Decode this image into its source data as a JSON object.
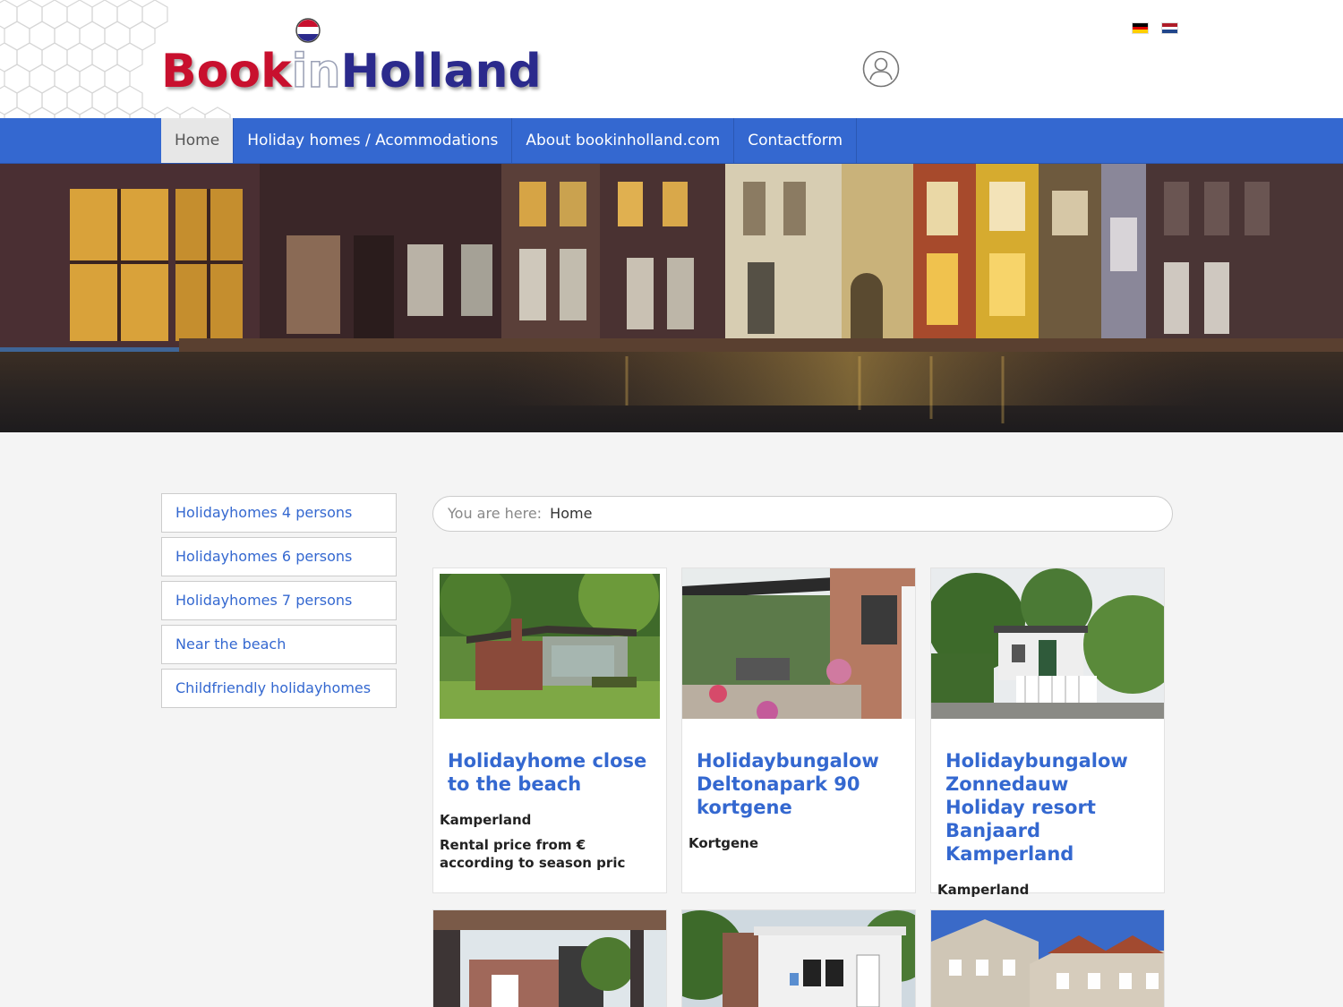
{
  "site": {
    "logo": {
      "part1": "Book",
      "part2": "in",
      "part3": "Holland"
    }
  },
  "header": {
    "languages": [
      {
        "name": "German",
        "colors": [
          "#000000",
          "#dd0000",
          "#ffce00"
        ]
      },
      {
        "name": "Dutch",
        "colors": [
          "#ae1c28",
          "#ffffff",
          "#21468b"
        ]
      }
    ]
  },
  "nav": {
    "items": [
      {
        "label": "Home",
        "active": true
      },
      {
        "label": "Holiday homes / Acommodations",
        "active": false
      },
      {
        "label": "About bookinholland.com",
        "active": false
      },
      {
        "label": "Contactform",
        "active": false
      }
    ]
  },
  "sidebar": {
    "items": [
      {
        "label": "Holidayhomes 4 persons"
      },
      {
        "label": "Holidayhomes 6 persons"
      },
      {
        "label": "Holidayhomes 7 persons"
      },
      {
        "label": "Near the beach"
      },
      {
        "label": "Childfriendly holidayhomes"
      }
    ]
  },
  "breadcrumb": {
    "label": "You are here:",
    "current": "Home"
  },
  "listings": [
    {
      "title": "Holidayhome close to the beach",
      "place": "Kamperland",
      "price": "Rental price from € according to season pric"
    },
    {
      "title": "Holidaybungalow Deltonapark 90 kortgene",
      "place": "Kortgene",
      "price": ""
    },
    {
      "title": "Holidaybungalow Zonnedauw Holiday resort Banjaard Kamperland",
      "place": "Kamperland",
      "price": ""
    }
  ],
  "colors": {
    "brand_blue": "#3468d0",
    "brand_red": "#c8102e",
    "logo_dark_blue": "#2b2a8c"
  }
}
